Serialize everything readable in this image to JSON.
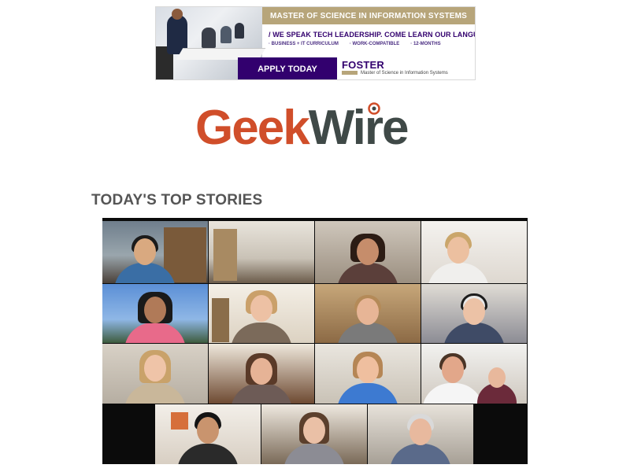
{
  "ad": {
    "title": "MASTER OF SCIENCE IN INFORMATION SYSTEMS",
    "tagline": "/ WE SPEAK TECH LEADERSHIP. COME LEARN OUR LANGUAGE.",
    "bullets": [
      "· BUSINESS + IT CURRICULUM",
      "· WORK-COMPATIBLE",
      "· 12-MONTHS"
    ],
    "cta": "APPLY TODAY",
    "brand": "FOSTER",
    "brand_subtitle": "Master of Science in Information Systems",
    "colors": {
      "purple": "#32006e",
      "gold": "#b7a57a"
    }
  },
  "logo": {
    "part1": "Geek",
    "part2": "Wire",
    "colors": {
      "geek": "#d04e2a",
      "wire": "#3f4947"
    }
  },
  "section": {
    "title": "TODAY'S TOP STORIES"
  },
  "story": {
    "image_icon": "video-call-grid-image"
  }
}
